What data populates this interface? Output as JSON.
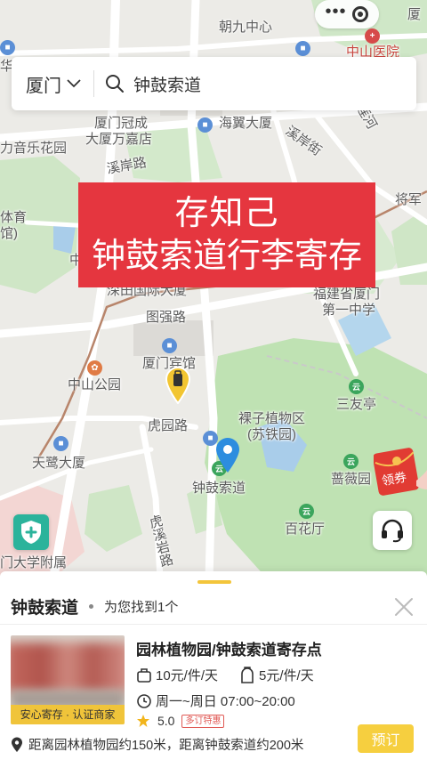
{
  "search": {
    "city": "厦门",
    "query": "钟鼓索道"
  },
  "banner": {
    "line1": "存知己",
    "line2": "钟鼓索道行李寄存"
  },
  "map": {
    "labels": {
      "chaojiu": "朝九中心",
      "zhongshan_hospital": "中山医院",
      "xiamen_guancheng": "厦门冠成",
      "wanjiadian": "大厦万嘉店",
      "haiyi": "海翼大厦",
      "xianlu": "溪岸路",
      "xianjie": "溪岸街",
      "yinlehuayuan": "力音乐花园",
      "tiyu": "体育",
      "guan": "馆)",
      "jiangjun": "将军",
      "lian_he": "莲河",
      "shentian": "深田国际大厦",
      "tuqiang": "图强路",
      "fujian_school": "福建省厦门",
      "first_school": "第一中学",
      "xiamen_hotel": "厦门宾馆",
      "zhongshan_park": "中山公园",
      "luoziyuan": "裸子植物区",
      "sutieyuan": "(苏铁园)",
      "sanyouting": "三友亭",
      "huyuan": "虎园路",
      "tianlu": "天鹭大厦",
      "weiyuan": "蔷薇园",
      "zhonggu": "钟鼓索道",
      "huxi": "虎溪岩路",
      "baihua": "百花厅",
      "university": "门大学附属",
      "zhong_partial": "中",
      "ping_partial": "华",
      "xia_right": "厦",
      "hospital_partial": "中山医院"
    },
    "coupon_label": "领券"
  },
  "sheet": {
    "title": "钟鼓索道",
    "result_count": "为您找到1个"
  },
  "store": {
    "name": "园林植物园/钟鼓索道寄存点",
    "badge": "安心寄存 · 认证商家",
    "price_small": "10元/件/天",
    "price_large": "5元/件/天",
    "hours": "周一~周日 07:00~20:00",
    "rating": "5.0",
    "promo": "多订特惠",
    "distance": "距离园林植物园约150米，距离钟鼓索道约200米",
    "book_label": "预订"
  },
  "colors": {
    "banner_red": "#e5363f",
    "accent_yellow": "#f6cf3f",
    "park_green": "#b9dfb0",
    "water_blue": "#a9cdea"
  }
}
